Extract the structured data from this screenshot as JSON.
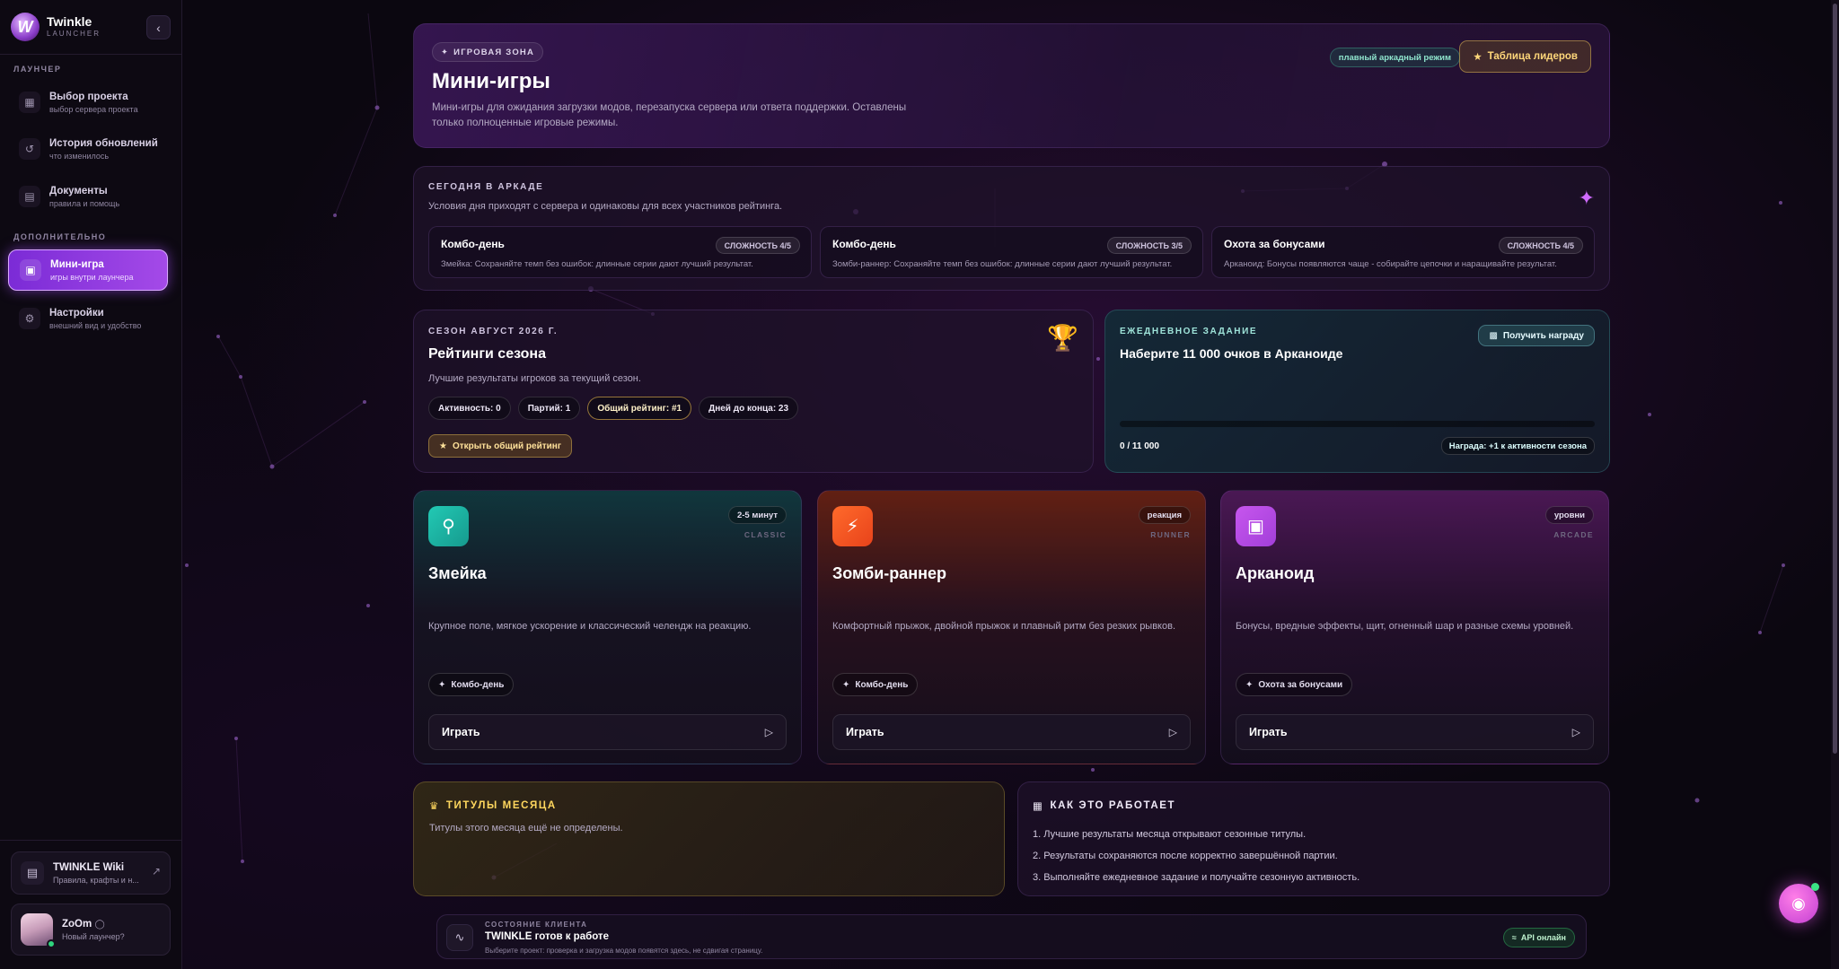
{
  "app": {
    "name": "Twinkle",
    "sub": "LAUNCHER",
    "logo_letter": "W",
    "collapse_icon": "chevron-left-icon"
  },
  "sidebar": {
    "section_main": "ЛАУНЧЕР",
    "section_extra": "ДОПОЛНИТЕЛЬНО",
    "items": [
      {
        "title": "Выбор проекта",
        "sub": "выбор сервера проекта",
        "icon": "grid-icon"
      },
      {
        "title": "История обновлений",
        "sub": "что изменилось",
        "icon": "history-icon"
      },
      {
        "title": "Документы",
        "sub": "правила и помощь",
        "icon": "document-icon"
      },
      {
        "title": "Мини-игра",
        "sub": "игры внутри лаунчера",
        "icon": "gamepad-icon",
        "active": true
      },
      {
        "title": "Настройки",
        "sub": "внешний вид и удобство",
        "icon": "gear-icon"
      }
    ],
    "wiki": {
      "title": "TWINKLE Wiki",
      "sub": "Правила, крафты и н...",
      "icon": "book-icon"
    },
    "user": {
      "name": "ZoOm",
      "sub": "Новый лаунчер?"
    }
  },
  "hero": {
    "tag": "ИГРОВАЯ ЗОНА",
    "title": "Мини-игры",
    "desc": "Мини-игры для ожидания загрузки модов, перезапуска сервера или ответа поддержки. Оставлены только полноценные игровые режимы.",
    "mode_pill": "плавный аркадный режим",
    "leaderboard_btn": "Таблица лидеров"
  },
  "today": {
    "eyebrow": "СЕГОДНЯ В АРКАДЕ",
    "desc": "Условия дня приходят с сервера и одинаковы для всех участников рейтинга.",
    "challenges": [
      {
        "title": "Комбо-день",
        "difficulty": "СЛОЖНОСТЬ 4/5",
        "desc": "Змейка: Сохраняйте темп без ошибок: длинные серии дают лучший результат."
      },
      {
        "title": "Комбо-день",
        "difficulty": "СЛОЖНОСТЬ 3/5",
        "desc": "Зомби-раннер: Сохраняйте темп без ошибок: длинные серии дают лучший результат."
      },
      {
        "title": "Охота за бонусами",
        "difficulty": "СЛОЖНОСТЬ 4/5",
        "desc": "Арканоид: Бонусы появляются чаще - собирайте цепочки и наращивайте результат."
      }
    ]
  },
  "season": {
    "eyebrow": "СЕЗОН АВГУСТ 2026 Г.",
    "title": "Рейтинги сезона",
    "desc": "Лучшие результаты игроков за текущий сезон.",
    "stats": [
      "Активность: 0",
      "Партий: 1",
      "Общий рейтинг: #1",
      "Дней до конца: 23"
    ],
    "open_btn": "Открыть общий рейтинг"
  },
  "daily": {
    "eyebrow": "ЕЖЕДНЕВНОЕ ЗАДАНИЕ",
    "title": "Наберите 11 000 очков в Арканоиде",
    "claim_btn": "Получить награду",
    "progress_text": "0 / 11 000",
    "progress_fraction": 0,
    "reward": "Награда: +1 к активности сезона"
  },
  "games": [
    {
      "title": "Змейка",
      "badge": "2-5 минут",
      "genre": "CLASSIC",
      "desc": "Крупное поле, мягкое ускорение и классический челендж на реакцию.",
      "tag": "Комбо-день",
      "play": "Играть",
      "icon": "joystick-icon"
    },
    {
      "title": "Зомби-раннер",
      "badge": "реакция",
      "genre": "RUNNER",
      "desc": "Комфортный прыжок, двойной прыжок и плавный ритм без резких рывков.",
      "tag": "Комбо-день",
      "play": "Играть",
      "icon": "bolt-icon"
    },
    {
      "title": "Арканоид",
      "badge": "уровни",
      "genre": "ARCADE",
      "desc": "Бонусы, вредные эффекты, щит, огненный шар и разные схемы уровней.",
      "tag": "Охота за бонусами",
      "play": "Играть",
      "icon": "gamepad-icon"
    }
  ],
  "titles": {
    "head": "ТИТУЛЫ МЕСЯЦА",
    "desc": "Титулы этого месяца ещё не определены."
  },
  "how": {
    "head": "КАК ЭТО РАБОТАЕТ",
    "items": [
      "1. Лучшие результаты месяца открывают сезонные титулы.",
      "2. Результаты сохраняются после корректно завершённой партии.",
      "3. Выполняйте ежедневное задание и получайте сезонную активность."
    ]
  },
  "status": {
    "eyebrow": "СОСТОЯНИЕ КЛИЕНТА",
    "title": "TWINKLE готов к работе",
    "sub": "Выберите проект: проверка и загрузка модов появятся здесь, не сдвигая страницу.",
    "api": "API онлайн"
  },
  "colors": {
    "accent": "#a44ae8",
    "gold": "#ffd75e",
    "teal": "#37d6c5",
    "background": "#0b0710"
  }
}
